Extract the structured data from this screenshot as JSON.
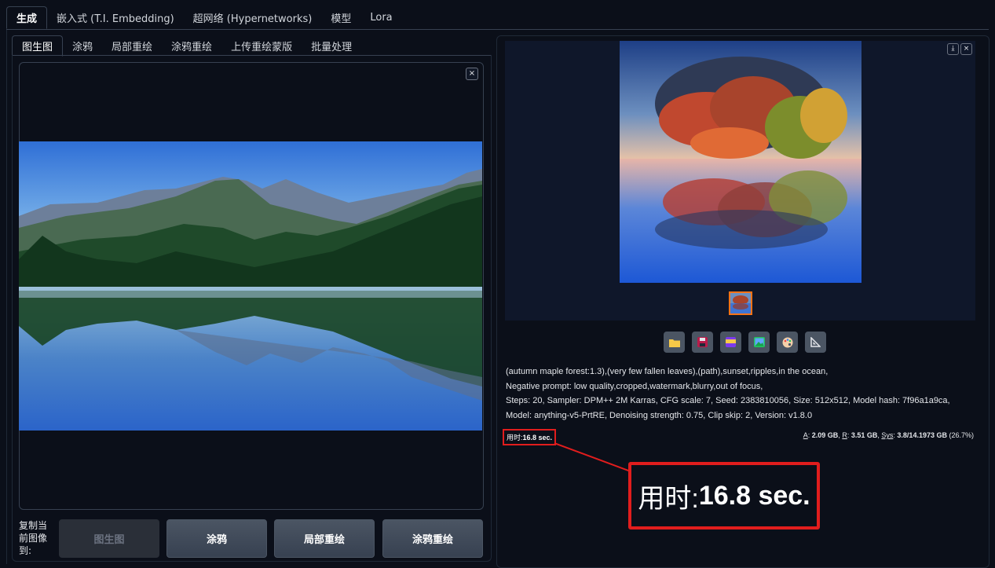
{
  "top_tabs": [
    "生成",
    "嵌入式 (T.I. Embedding)",
    "超网络 (Hypernetworks)",
    "模型",
    "Lora"
  ],
  "sub_tabs": [
    "图生图",
    "涂鸦",
    "局部重绘",
    "涂鸦重绘",
    "上传重绘蒙版",
    "批量处理"
  ],
  "copy": {
    "label": "复制当前图像到:",
    "buttons": [
      "图生图",
      "涂鸦",
      "局部重绘",
      "涂鸦重绘"
    ]
  },
  "icons": {
    "close": "×",
    "download": "⤓",
    "toolbar": [
      "folder-icon",
      "save-icon",
      "zip-icon",
      "image-icon",
      "palette-icon",
      "ruler-icon"
    ]
  },
  "info": {
    "prompt": "(autumn maple forest:1.3),(very few fallen leaves),(path),sunset,ripples,in the ocean,",
    "negative": "Negative prompt: low quality,cropped,watermark,blurry,out of focus,",
    "params": "Steps: 20, Sampler: DPM++ 2M Karras, CFG scale: 7, Seed: 2383810056, Size: 512x512, Model hash: 7f96a1a9ca, Model: anything-v5-PrtRE, Denoising strength: 0.75, Clip skip: 2, Version: v1.8.0"
  },
  "timing": {
    "label": "用时:",
    "value": "16.8 sec."
  },
  "memory": {
    "a_label": "A",
    "a_value": "2.09 GB",
    "r_label": "R",
    "r_value": "3.51 GB",
    "sys_label": "Sys",
    "sys_value": "3.8/14.1973 GB",
    "pct": "(26.7%)"
  },
  "colors": {
    "background": "#0b0f19",
    "highlight": "#e11d1d",
    "thumb_border": "#f97316"
  }
}
